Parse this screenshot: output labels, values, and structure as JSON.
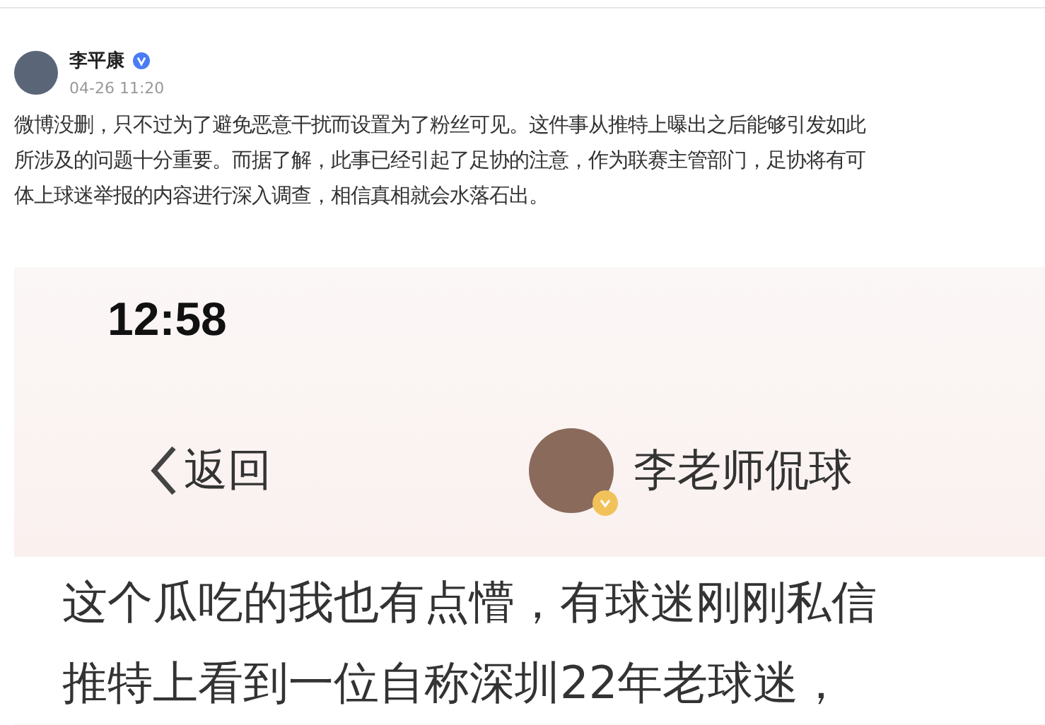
{
  "post": {
    "author": "李平康",
    "verified": true,
    "time": "04-26 11:20",
    "lines": [
      "微博没删，只不过为了避免恶意干扰而设置为了粉丝可见。这件事从推特上曝出之后能够引发如此",
      "所涉及的问题十分重要。而据了解，此事已经引起了足协的注意，作为联赛主管部门，足协将有可",
      "体上球迷举报的内容进行深入调查，相信真相就会水落石出。"
    ]
  },
  "screenshot": {
    "clock": "12:58",
    "back_label": "返回",
    "account_name": "李老师侃球",
    "account_verified": true,
    "lines": [
      "这个瓜吃的我也有点懵，有球迷刚刚私信",
      "推特上看到一位自称深圳22年老球迷，"
    ]
  }
}
